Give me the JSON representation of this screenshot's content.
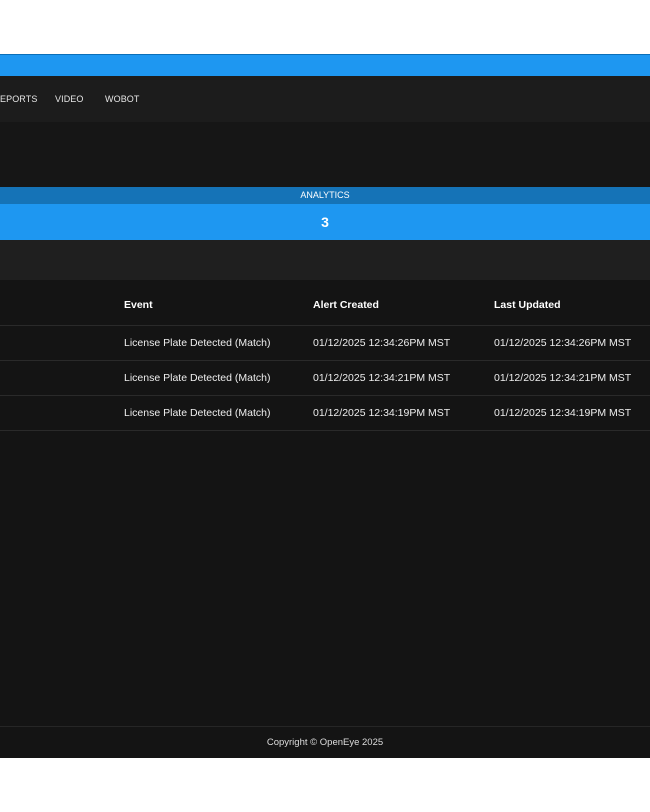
{
  "nav": {
    "items": [
      {
        "label": "EPORTS"
      },
      {
        "label": "VIDEO"
      },
      {
        "label": "WOBOT"
      }
    ]
  },
  "analytics": {
    "title": "ANALYTICS",
    "value": "3"
  },
  "table": {
    "columns": [
      "Event",
      "Alert Created",
      "Last Updated"
    ],
    "rows": [
      {
        "event": "License Plate Detected (Match)",
        "created": "01/12/2025 12:34:26PM MST",
        "updated": "01/12/2025 12:34:26PM MST"
      },
      {
        "event": "License Plate Detected (Match)",
        "created": "01/12/2025 12:34:21PM MST",
        "updated": "01/12/2025 12:34:21PM MST"
      },
      {
        "event": "License Plate Detected (Match)",
        "created": "01/12/2025 12:34:19PM MST",
        "updated": "01/12/2025 12:34:19PM MST"
      }
    ]
  },
  "footer": {
    "text": "Copyright © OpenEye 2025"
  },
  "colors": {
    "accent": "#1e97f1",
    "accent_dark": "#1573b7",
    "background": "#141414"
  }
}
